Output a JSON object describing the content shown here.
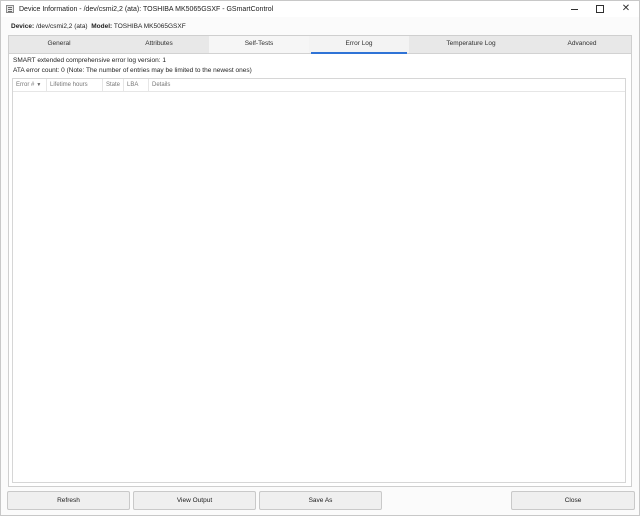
{
  "window": {
    "title": "Device Information - /dev/csmi2,2 (ata): TOSHIBA MK5065GSXF - GSmartControl",
    "controls": {
      "minimize": "",
      "maximize": "",
      "close": "✕"
    }
  },
  "device": {
    "device_label": "Device:",
    "device_value": "/dev/csmi2,2 (ata)",
    "model_label": "Model:",
    "model_value": "TOSHIBA MK5065GSXF"
  },
  "tabs": [
    {
      "label": "General"
    },
    {
      "label": "Attributes"
    },
    {
      "label": "Self-Tests"
    },
    {
      "label": "Error Log"
    },
    {
      "label": "Temperature Log"
    },
    {
      "label": "Advanced"
    }
  ],
  "active_tab": "Error Log",
  "error_log": {
    "version_line": "SMART extended comprehensive error log version: 1",
    "count_line": "ATA error count: 0 (Note: The number of entries may be limited to the newest ones)",
    "columns": [
      "Error #",
      "Lifetime hours",
      "State",
      "LBA",
      "Details"
    ],
    "sort_indicator": "▼",
    "rows": []
  },
  "buttons": {
    "refresh": "Refresh",
    "view_output": "View Output",
    "save_as": "Save As",
    "close": "Close"
  }
}
